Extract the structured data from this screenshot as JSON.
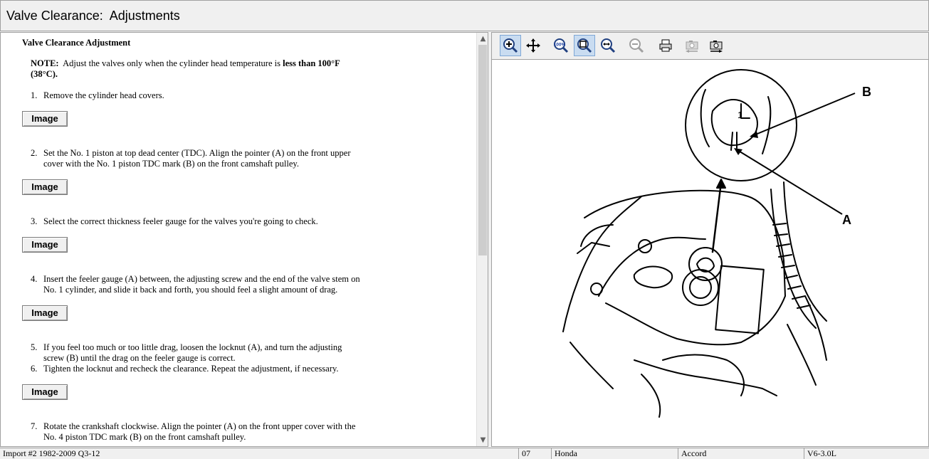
{
  "window": {
    "title": "Valve Clearance:  Adjustments"
  },
  "document": {
    "heading": "Valve Clearance Adjustment",
    "note": {
      "label": "NOTE:",
      "text": "Adjust the valves only when the cylinder head temperature is",
      "emphasis": "less than 100°F (38°C)."
    },
    "image_button_label": "Image",
    "steps": [
      {
        "num": "1.",
        "text": "Remove the cylinder head covers."
      },
      {
        "num": "2.",
        "text": "Set the No. 1 piston at top dead center (TDC). Align the pointer (A) on the front upper cover with the No. 1 piston TDC mark (B) on the front camshaft pulley."
      },
      {
        "num": "3.",
        "text": "Select the correct thickness feeler gauge for the valves you're going to check."
      },
      {
        "num": "4.",
        "text": "Insert the feeler gauge (A) between, the adjusting screw and the end of the valve stem on No. 1 cylinder, and slide it back and forth, you should feel a slight amount of drag."
      },
      {
        "num": "5.",
        "text": "If you feel too much or too little drag, loosen the locknut (A), and turn the adjusting screw (B) until the drag on the feeler gauge is correct."
      },
      {
        "num": "6.",
        "text": "Tighten the locknut and recheck the clearance. Repeat the adjustment, if necessary."
      },
      {
        "num": "7.",
        "text": "Rotate the crankshaft clockwise. Align the pointer (A) on the front upper cover with the No. 4 piston TDC mark (B) on the front camshaft pulley."
      }
    ]
  },
  "toolbar": {
    "tools": [
      {
        "name": "zoom-in-tool",
        "icon": "zoom-in-icon",
        "active": true
      },
      {
        "name": "pan-tool",
        "icon": "pan-icon",
        "active": false
      },
      {
        "name": "actual-size-tool",
        "icon": "zoom-100-icon",
        "active": false
      },
      {
        "name": "fit-window-tool",
        "icon": "fit-window-icon",
        "active": true
      },
      {
        "name": "fit-width-tool",
        "icon": "fit-width-icon",
        "active": false
      },
      {
        "name": "zoom-out-tool",
        "icon": "zoom-out-icon",
        "active": false
      },
      {
        "name": "print-tool",
        "icon": "print-icon",
        "active": false
      },
      {
        "name": "previous-image-tool",
        "icon": "camera-prev-icon",
        "active": false
      },
      {
        "name": "next-image-tool",
        "icon": "camera-next-icon",
        "active": false
      }
    ]
  },
  "diagram": {
    "label_a": "A",
    "label_b": "B",
    "pulley_mark": "1"
  },
  "status": {
    "import": "Import #2 1982-2009 Q3-12",
    "year": "07",
    "make": "Honda",
    "model": "Accord",
    "engine": "V6-3.0L"
  },
  "colors": {
    "active_tool": "#c9dcf1",
    "chrome": "#f0f0f0",
    "border": "#a0a0a0"
  }
}
